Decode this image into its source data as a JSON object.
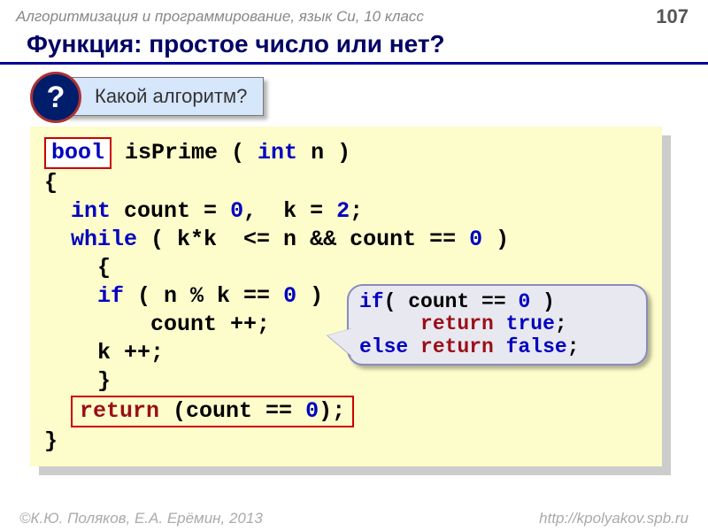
{
  "header": {
    "course": "Алгоритмизация и программирование, язык Си, 10 класс",
    "page": "107"
  },
  "title": "Функция: простое число или нет?",
  "question": {
    "mark": "?",
    "text": "Какой алгоритм?"
  },
  "code": {
    "bool": "bool",
    "sig_rest1": " isPrime ( ",
    "int_kw": "int",
    "sig_rest2": " n )",
    "lbrace": "{",
    "decl1": "  ",
    "decl_int": "int",
    "decl_rest": " count = ",
    "zero1": "0",
    "decl_rest2": ",  k = ",
    "two": "2",
    "decl_semi": ";",
    "while_kw": "while",
    "while_rest": " ( k*k  <= n && count == ",
    "zero2": "0",
    "while_close": " )",
    "ib_open": "    {",
    "if_kw": "if",
    "if_rest": " ( n % k == ",
    "zero3": "0",
    "if_close": " )",
    "count_inc": "        count ++;",
    "k_inc": "    k ++;",
    "ib_close": "    }",
    "return_kw": "return",
    "return_rest": " (count == ",
    "zero4": "0",
    "return_close": ");",
    "rbrace": "}"
  },
  "callout": {
    "if_kw": "if",
    "if_rest": "( count == ",
    "zero": "0",
    "if_close": " )",
    "return1_kw": "return",
    "true_kw": "true",
    "semi1": ";",
    "else_kw": "else",
    "return2_kw": "return",
    "false_kw": "false",
    "semi2": ";"
  },
  "footer": {
    "left": "©К.Ю. Поляков, Е.А. Ерёмин, 2013",
    "right": "http://kpolyakov.spb.ru"
  }
}
